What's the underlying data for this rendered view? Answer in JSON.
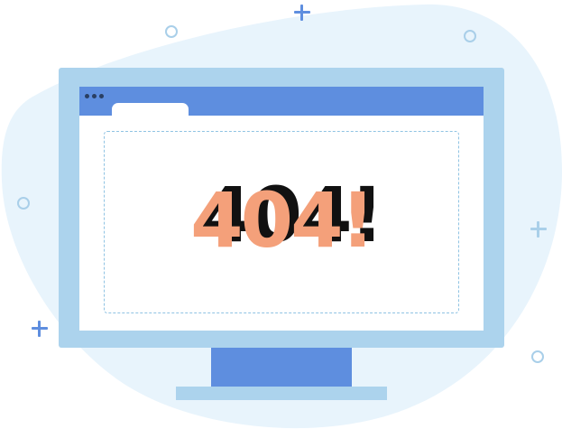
{
  "illustration": {
    "error_code": "404!"
  },
  "colors": {
    "blob": "#e8f4fc",
    "monitor_frame": "#acd3ed",
    "titlebar": "#5e8edf",
    "stand": "#5e8edf",
    "base": "#acd3ed",
    "error_text": "#f4a07a",
    "error_shadow": "#111111",
    "dashed_border": "#8fc3e3",
    "plus_accent": "#5e8edf",
    "plus_light": "#a9cfe9"
  }
}
